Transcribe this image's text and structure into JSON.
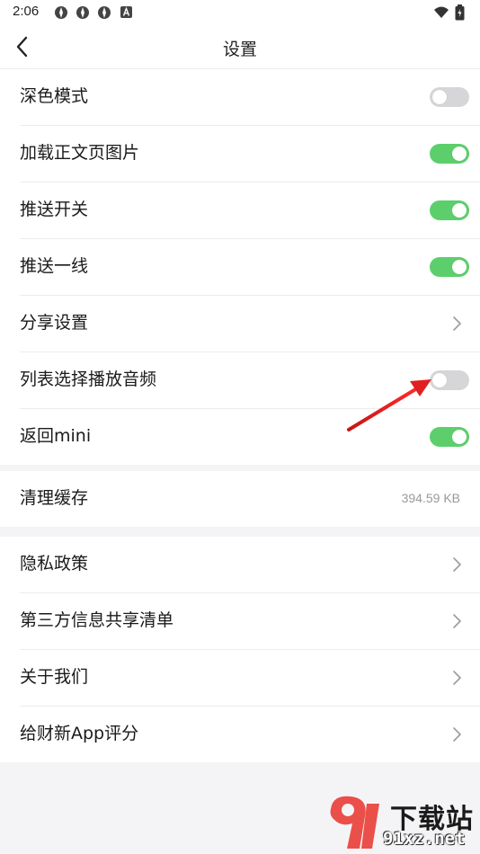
{
  "status_bar": {
    "time": "2:06",
    "notification_icons": [
      "app-icon",
      "app-icon",
      "app-icon",
      "text-a-icon"
    ],
    "right_icons": [
      "wifi-icon",
      "battery-icon"
    ]
  },
  "nav": {
    "title": "设置",
    "back_icon": "chevron-left-icon"
  },
  "group1": {
    "rows": [
      {
        "label": "深色模式",
        "control": "toggle",
        "on": false
      },
      {
        "label": "加载正文页图片",
        "control": "toggle",
        "on": true
      },
      {
        "label": "推送开关",
        "control": "toggle",
        "on": true
      },
      {
        "label": "推送一线",
        "control": "toggle",
        "on": true
      },
      {
        "label": "分享设置",
        "control": "chevron"
      },
      {
        "label": "列表选择播放音频",
        "control": "toggle",
        "on": false
      },
      {
        "label": "返回mini",
        "control": "toggle",
        "on": true
      }
    ]
  },
  "group2": {
    "cache_label": "清理缓存",
    "cache_value": "394.59 KB"
  },
  "group3": {
    "rows": [
      {
        "label": "隐私政策"
      },
      {
        "label": "第三方信息共享清单"
      },
      {
        "label": "关于我们"
      },
      {
        "label": "给财新App评分"
      }
    ]
  },
  "watermark": {
    "logo_text": "下载站",
    "site": "91xz.net"
  },
  "colors": {
    "toggle_on": "#5ccf6c",
    "toggle_off": "#d6d6d8",
    "annotation_arrow": "#e02020",
    "page_bg": "#f4f4f6"
  }
}
